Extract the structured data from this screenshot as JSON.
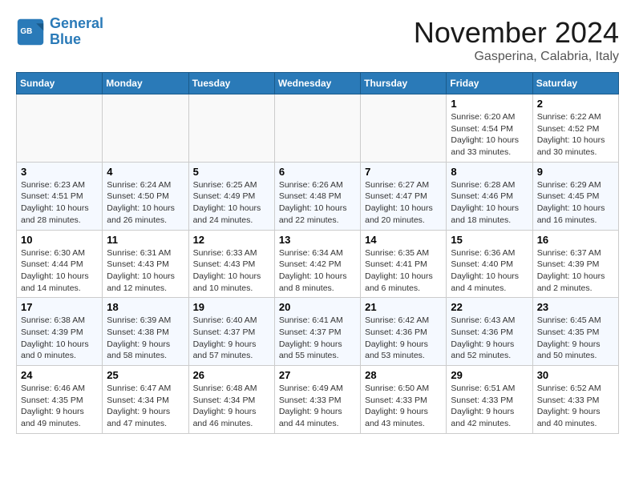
{
  "header": {
    "logo_general": "General",
    "logo_blue": "Blue",
    "month_title": "November 2024",
    "location": "Gasperina, Calabria, Italy"
  },
  "days_of_week": [
    "Sunday",
    "Monday",
    "Tuesday",
    "Wednesday",
    "Thursday",
    "Friday",
    "Saturday"
  ],
  "weeks": [
    [
      {
        "day": "",
        "info": ""
      },
      {
        "day": "",
        "info": ""
      },
      {
        "day": "",
        "info": ""
      },
      {
        "day": "",
        "info": ""
      },
      {
        "day": "",
        "info": ""
      },
      {
        "day": "1",
        "info": "Sunrise: 6:20 AM\nSunset: 4:54 PM\nDaylight: 10 hours\nand 33 minutes."
      },
      {
        "day": "2",
        "info": "Sunrise: 6:22 AM\nSunset: 4:52 PM\nDaylight: 10 hours\nand 30 minutes."
      }
    ],
    [
      {
        "day": "3",
        "info": "Sunrise: 6:23 AM\nSunset: 4:51 PM\nDaylight: 10 hours\nand 28 minutes."
      },
      {
        "day": "4",
        "info": "Sunrise: 6:24 AM\nSunset: 4:50 PM\nDaylight: 10 hours\nand 26 minutes."
      },
      {
        "day": "5",
        "info": "Sunrise: 6:25 AM\nSunset: 4:49 PM\nDaylight: 10 hours\nand 24 minutes."
      },
      {
        "day": "6",
        "info": "Sunrise: 6:26 AM\nSunset: 4:48 PM\nDaylight: 10 hours\nand 22 minutes."
      },
      {
        "day": "7",
        "info": "Sunrise: 6:27 AM\nSunset: 4:47 PM\nDaylight: 10 hours\nand 20 minutes."
      },
      {
        "day": "8",
        "info": "Sunrise: 6:28 AM\nSunset: 4:46 PM\nDaylight: 10 hours\nand 18 minutes."
      },
      {
        "day": "9",
        "info": "Sunrise: 6:29 AM\nSunset: 4:45 PM\nDaylight: 10 hours\nand 16 minutes."
      }
    ],
    [
      {
        "day": "10",
        "info": "Sunrise: 6:30 AM\nSunset: 4:44 PM\nDaylight: 10 hours\nand 14 minutes."
      },
      {
        "day": "11",
        "info": "Sunrise: 6:31 AM\nSunset: 4:43 PM\nDaylight: 10 hours\nand 12 minutes."
      },
      {
        "day": "12",
        "info": "Sunrise: 6:33 AM\nSunset: 4:43 PM\nDaylight: 10 hours\nand 10 minutes."
      },
      {
        "day": "13",
        "info": "Sunrise: 6:34 AM\nSunset: 4:42 PM\nDaylight: 10 hours\nand 8 minutes."
      },
      {
        "day": "14",
        "info": "Sunrise: 6:35 AM\nSunset: 4:41 PM\nDaylight: 10 hours\nand 6 minutes."
      },
      {
        "day": "15",
        "info": "Sunrise: 6:36 AM\nSunset: 4:40 PM\nDaylight: 10 hours\nand 4 minutes."
      },
      {
        "day": "16",
        "info": "Sunrise: 6:37 AM\nSunset: 4:39 PM\nDaylight: 10 hours\nand 2 minutes."
      }
    ],
    [
      {
        "day": "17",
        "info": "Sunrise: 6:38 AM\nSunset: 4:39 PM\nDaylight: 10 hours\nand 0 minutes."
      },
      {
        "day": "18",
        "info": "Sunrise: 6:39 AM\nSunset: 4:38 PM\nDaylight: 9 hours\nand 58 minutes."
      },
      {
        "day": "19",
        "info": "Sunrise: 6:40 AM\nSunset: 4:37 PM\nDaylight: 9 hours\nand 57 minutes."
      },
      {
        "day": "20",
        "info": "Sunrise: 6:41 AM\nSunset: 4:37 PM\nDaylight: 9 hours\nand 55 minutes."
      },
      {
        "day": "21",
        "info": "Sunrise: 6:42 AM\nSunset: 4:36 PM\nDaylight: 9 hours\nand 53 minutes."
      },
      {
        "day": "22",
        "info": "Sunrise: 6:43 AM\nSunset: 4:36 PM\nDaylight: 9 hours\nand 52 minutes."
      },
      {
        "day": "23",
        "info": "Sunrise: 6:45 AM\nSunset: 4:35 PM\nDaylight: 9 hours\nand 50 minutes."
      }
    ],
    [
      {
        "day": "24",
        "info": "Sunrise: 6:46 AM\nSunset: 4:35 PM\nDaylight: 9 hours\nand 49 minutes."
      },
      {
        "day": "25",
        "info": "Sunrise: 6:47 AM\nSunset: 4:34 PM\nDaylight: 9 hours\nand 47 minutes."
      },
      {
        "day": "26",
        "info": "Sunrise: 6:48 AM\nSunset: 4:34 PM\nDaylight: 9 hours\nand 46 minutes."
      },
      {
        "day": "27",
        "info": "Sunrise: 6:49 AM\nSunset: 4:33 PM\nDaylight: 9 hours\nand 44 minutes."
      },
      {
        "day": "28",
        "info": "Sunrise: 6:50 AM\nSunset: 4:33 PM\nDaylight: 9 hours\nand 43 minutes."
      },
      {
        "day": "29",
        "info": "Sunrise: 6:51 AM\nSunset: 4:33 PM\nDaylight: 9 hours\nand 42 minutes."
      },
      {
        "day": "30",
        "info": "Sunrise: 6:52 AM\nSunset: 4:33 PM\nDaylight: 9 hours\nand 40 minutes."
      }
    ]
  ]
}
